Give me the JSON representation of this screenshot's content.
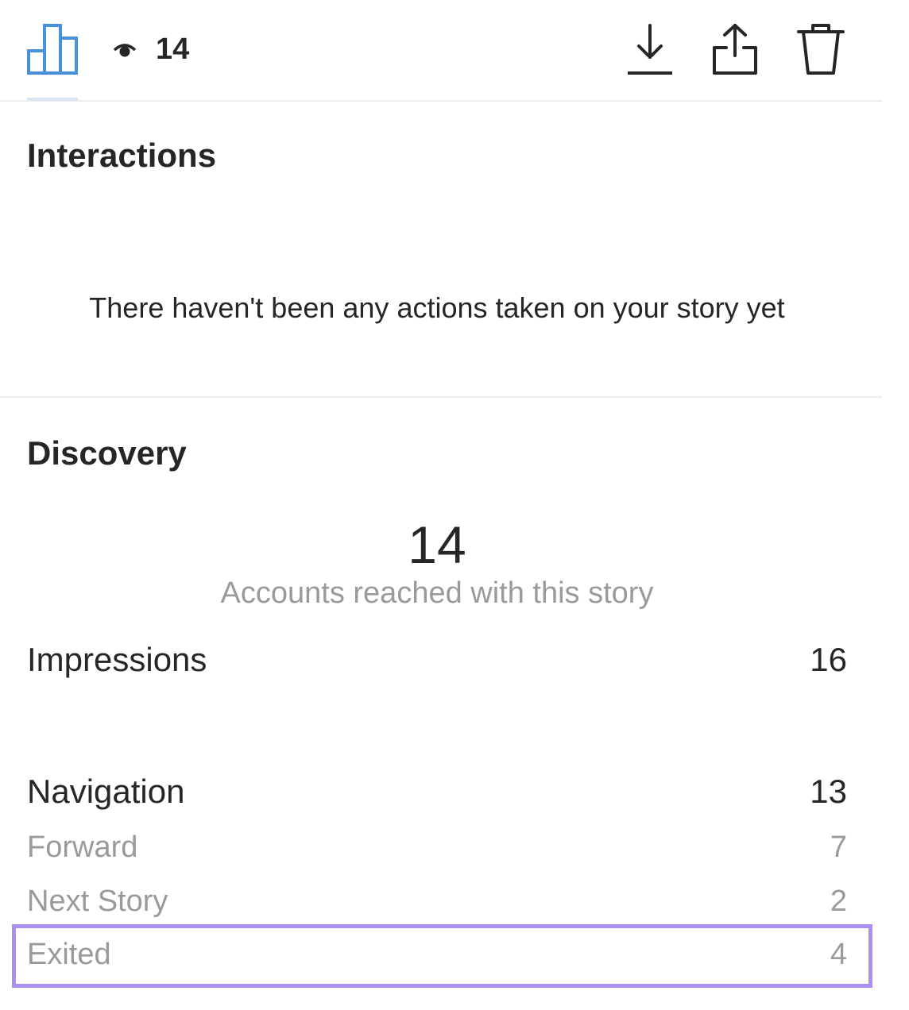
{
  "header": {
    "insights_tab_icon": "bar-chart-icon",
    "views_icon": "eye-icon",
    "views_count": "14",
    "actions": [
      {
        "name": "download",
        "icon": "download-icon"
      },
      {
        "name": "share",
        "icon": "share-icon"
      },
      {
        "name": "delete",
        "icon": "trash-icon"
      }
    ]
  },
  "interactions": {
    "title": "Interactions",
    "empty_message": "There haven't been any actions taken on your story yet"
  },
  "discovery": {
    "title": "Discovery",
    "accounts_reached": "14",
    "accounts_reached_label": "Accounts reached with this story",
    "impressions": {
      "label": "Impressions",
      "value": "16"
    },
    "navigation": {
      "label": "Navigation",
      "value": "13",
      "items": [
        {
          "label": "Forward",
          "value": "7"
        },
        {
          "label": "Next Story",
          "value": "2"
        },
        {
          "label": "Exited",
          "value": "4"
        }
      ]
    }
  },
  "colors": {
    "accent_blue": "#4a90d9",
    "text_primary": "#262626",
    "text_secondary": "#9a9a9a",
    "highlight": "#a98ff0"
  }
}
